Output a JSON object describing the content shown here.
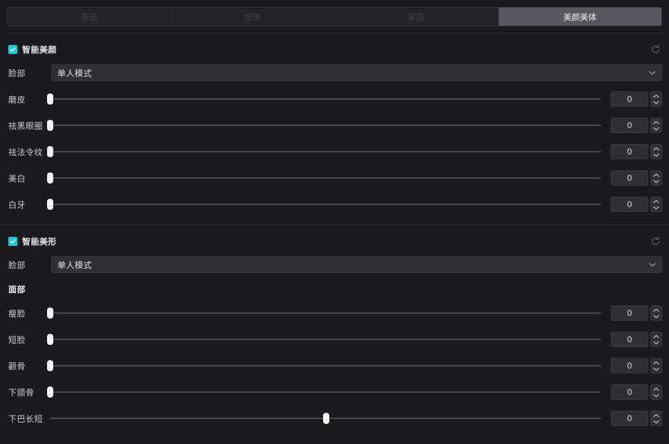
{
  "tabs": [
    {
      "label": "基础",
      "active": false
    },
    {
      "label": "抠像",
      "active": false
    },
    {
      "label": "蒙版",
      "active": false
    },
    {
      "label": "美颜美体",
      "active": true
    }
  ],
  "colors": {
    "accent": "#1ec8d8",
    "panel_bg": "#1b1b1d",
    "tab_active_bg": "#57575e",
    "field_bg": "#303034",
    "handle": "#f3f3f3"
  },
  "sections": [
    {
      "id": "smart-beauty",
      "title": "智能美颜",
      "checked": true,
      "reset_icon": "reset-icon",
      "mode_row": {
        "label": "脸部",
        "value": "单人模式",
        "options": [
          "单人模式"
        ],
        "chevron_icon": "chevron-down-icon"
      },
      "subsections": [
        {
          "title": "",
          "sliders": [
            {
              "label": "磨皮",
              "value": "0",
              "percent": 0,
              "bipolar": false
            },
            {
              "label": "祛黑眼圈",
              "value": "0",
              "percent": 0,
              "bipolar": false
            },
            {
              "label": "祛法令纹",
              "value": "0",
              "percent": 0,
              "bipolar": false
            },
            {
              "label": "美白",
              "value": "0",
              "percent": 0,
              "bipolar": false
            },
            {
              "label": "白牙",
              "value": "0",
              "percent": 0,
              "bipolar": false
            }
          ]
        }
      ]
    },
    {
      "id": "smart-reshape",
      "title": "智能美形",
      "checked": true,
      "reset_icon": "reset-icon",
      "mode_row": {
        "label": "脸部",
        "value": "单人模式",
        "options": [
          "单人模式"
        ],
        "chevron_icon": "chevron-down-icon"
      },
      "subsections": [
        {
          "title": "面部",
          "sliders": [
            {
              "label": "瘦脸",
              "value": "0",
              "percent": 0,
              "bipolar": false
            },
            {
              "label": "短脸",
              "value": "0",
              "percent": 0,
              "bipolar": false
            },
            {
              "label": "颧骨",
              "value": "0",
              "percent": 0,
              "bipolar": false
            },
            {
              "label": "下颌骨",
              "value": "0",
              "percent": 0,
              "bipolar": false
            },
            {
              "label": "下巴长短",
              "value": "0",
              "percent": 50,
              "bipolar": true
            }
          ]
        }
      ]
    }
  ]
}
